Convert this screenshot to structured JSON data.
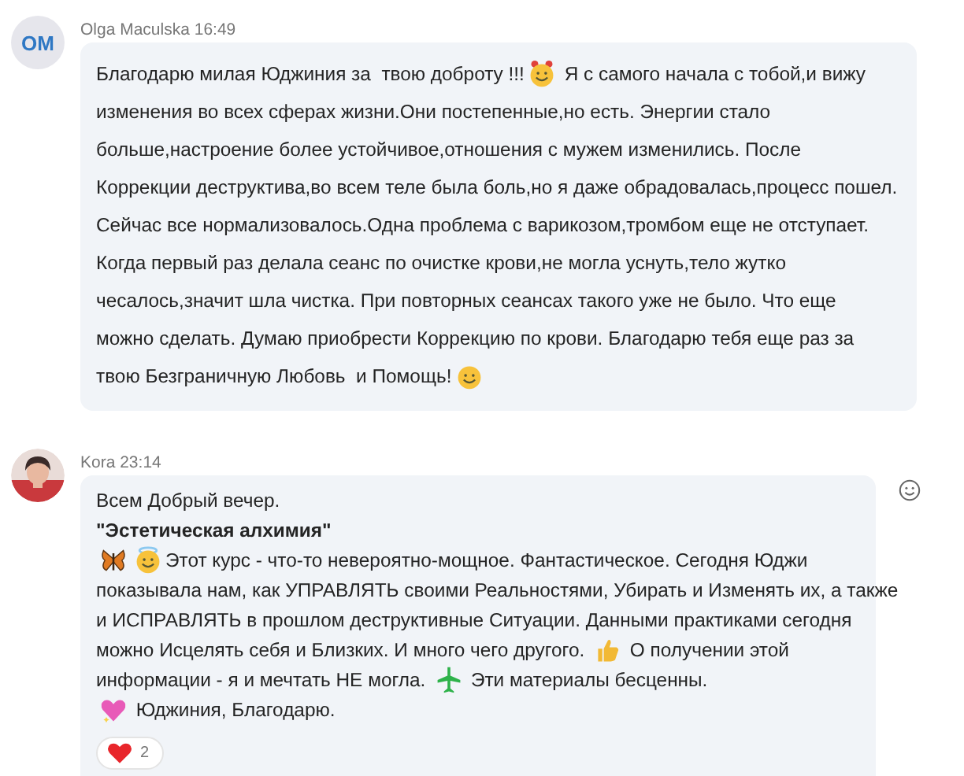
{
  "messages": [
    {
      "author": "Olga Maculska",
      "time": "16:49",
      "avatar": {
        "kind": "initials",
        "text": "OM"
      },
      "react_button": false,
      "lines": [
        [
          {
            "kind": "text",
            "text": "Благодарю милая Юджиния за  твою доброту !!!",
            "bold": false
          },
          {
            "kind": "horned-smiley"
          },
          {
            "kind": "text",
            "text": " Я с самого начала с тобой,и вижу",
            "bold": false
          }
        ],
        [
          {
            "kind": "text",
            "text": "изменения во всех сферах жизни.Они постепенные,но есть. Энергии стало",
            "bold": false
          }
        ],
        [
          {
            "kind": "text",
            "text": "больше,настроение более устойчивое,отношения с мужем изменились. После",
            "bold": false
          }
        ],
        [
          {
            "kind": "text",
            "text": "Коррекции деструктива,во всем теле была боль,но я даже обрадовалась,процесс пошел.",
            "bold": false
          }
        ],
        [
          {
            "kind": "text",
            "text": "Сейчас все нормализовалось.Одна проблема с варикозом,тромбом еще не отступает.",
            "bold": false
          }
        ],
        [
          {
            "kind": "text",
            "text": "Когда первый раз делала сеанс по очистке крови,не могла уснуть,тело жутко",
            "bold": false
          }
        ],
        [
          {
            "kind": "text",
            "text": "чесалось,значит шла чистка. При повторных сеансах такого уже не было. Что еще",
            "bold": false
          }
        ],
        [
          {
            "kind": "text",
            "text": "можно сделать. Думаю приобрести Коррекцию по крови. Благодарю тебя еще раз за",
            "bold": false
          }
        ],
        [
          {
            "kind": "text",
            "text": "твою Безграничную Любовь  и Помощь!",
            "bold": false
          },
          {
            "kind": "smiley"
          }
        ]
      ]
    },
    {
      "author": "Kora",
      "time": "23:14",
      "avatar": {
        "kind": "picture"
      },
      "react_button": true,
      "lines": [
        [
          {
            "kind": "text",
            "text": "Всем Добрый вечер.",
            "bold": false
          }
        ],
        [
          {
            "kind": "text",
            "text": "\"Эстетическая алхимия\"",
            "bold": true
          }
        ],
        [
          {
            "kind": "butterfly"
          },
          {
            "kind": "halo-smiley"
          },
          {
            "kind": "text",
            "text": "Этот курс - что-то невероятно-мощное. Фантастическое. Сегодня Юджи",
            "bold": false
          }
        ],
        [
          {
            "kind": "text",
            "text": "показывала нам, как УПРАВЛЯТЬ своими Реальностями, Убирать и Изменять их, а также",
            "bold": false
          }
        ],
        [
          {
            "kind": "text",
            "text": "и ИСПРАВЛЯТЬ в прошлом деструктивные Ситуации. Данными практиками сегодня",
            "bold": false
          }
        ],
        [
          {
            "kind": "text",
            "text": "можно Исцелять себя и Близких. И много чего другого. ",
            "bold": false
          },
          {
            "kind": "thumbs-up"
          },
          {
            "kind": "text",
            "text": " О получении этой",
            "bold": false
          }
        ],
        [
          {
            "kind": "text",
            "text": "информации - я и мечтать НЕ могла. ",
            "bold": false
          },
          {
            "kind": "airplane"
          },
          {
            "kind": "text",
            "text": " Эти материалы бесценны.",
            "bold": false
          }
        ],
        [
          {
            "kind": "sparkle-heart"
          },
          {
            "kind": "text",
            "text": " Юджиния, Благодарю.",
            "bold": false
          }
        ]
      ],
      "reactions": [
        {
          "count": "2"
        }
      ]
    }
  ]
}
